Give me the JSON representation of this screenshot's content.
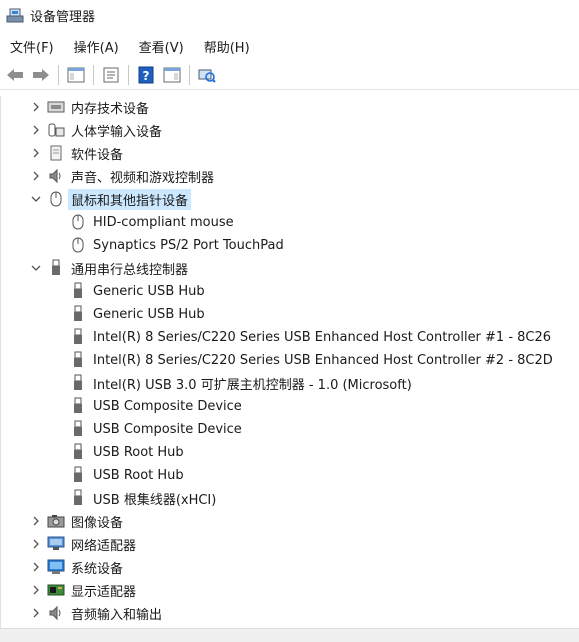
{
  "window": {
    "title": "设备管理器",
    "icon": "device-manager-icon"
  },
  "menu": [
    "文件(F)",
    "操作(A)",
    "查看(V)",
    "帮助(H)"
  ],
  "toolbar": {
    "buttons": [
      "back-icon",
      "forward-icon",
      "show-hide-console-tree-icon",
      "properties-icon",
      "help-icon",
      "action-pane-icon",
      "scan-hardware-icon"
    ]
  },
  "tree": {
    "categories": [
      {
        "label": "内存技术设备",
        "icon": "memory-chip-icon",
        "expanded": false
      },
      {
        "label": "人体学输入设备",
        "icon": "hid-icon",
        "expanded": false
      },
      {
        "label": "软件设备",
        "icon": "software-device-icon",
        "expanded": false
      },
      {
        "label": "声音、视频和游戏控制器",
        "icon": "speaker-icon",
        "expanded": false
      },
      {
        "label": "鼠标和其他指针设备",
        "icon": "mouse-icon",
        "expanded": true,
        "selected": true,
        "children": [
          "HID-compliant mouse",
          "Synaptics PS/2 Port TouchPad"
        ]
      },
      {
        "label": "通用串行总线控制器",
        "icon": "usb-icon",
        "expanded": true,
        "children": [
          "Generic USB Hub",
          "Generic USB Hub",
          "Intel(R) 8 Series/C220 Series USB Enhanced Host Controller #1 - 8C26",
          "Intel(R) 8 Series/C220 Series USB Enhanced Host Controller #2 - 8C2D",
          "Intel(R) USB 3.0 可扩展主机控制器 - 1.0 (Microsoft)",
          "USB Composite Device",
          "USB Composite Device",
          "USB Root Hub",
          "USB Root Hub",
          "USB 根集线器(xHCI)"
        ]
      },
      {
        "label": "图像设备",
        "icon": "camera-icon",
        "expanded": false
      },
      {
        "label": "网络适配器",
        "icon": "network-adapter-icon",
        "expanded": false
      },
      {
        "label": "系统设备",
        "icon": "system-device-icon",
        "expanded": false
      },
      {
        "label": "显示适配器",
        "icon": "display-adapter-icon",
        "expanded": false
      },
      {
        "label": "音频输入和输出",
        "icon": "audio-io-icon",
        "expanded": false
      }
    ]
  },
  "colors": {
    "selection": "#cce8ff",
    "accent": "#1e6fd9"
  }
}
